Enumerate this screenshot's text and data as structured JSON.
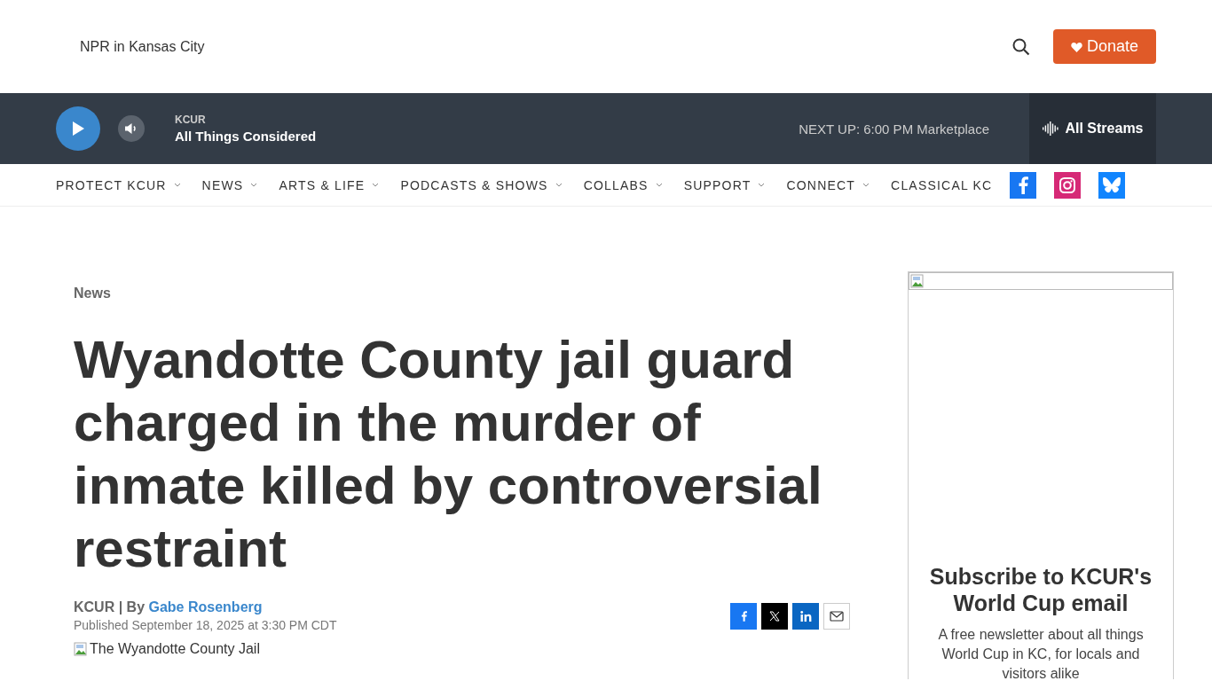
{
  "header": {
    "tagline": "NPR in Kansas City",
    "donate": "Donate"
  },
  "player": {
    "station": "KCUR",
    "show": "All Things Considered",
    "next_up": "NEXT UP: 6:00 PM Marketplace",
    "streams": "All Streams"
  },
  "nav": {
    "items": [
      {
        "label": "PROTECT KCUR",
        "dropdown": true
      },
      {
        "label": "NEWS",
        "dropdown": true
      },
      {
        "label": "ARTS & LIFE",
        "dropdown": true
      },
      {
        "label": "PODCASTS & SHOWS",
        "dropdown": true
      },
      {
        "label": "COLLABS",
        "dropdown": true
      },
      {
        "label": "SUPPORT",
        "dropdown": true
      },
      {
        "label": "CONNECT",
        "dropdown": true
      },
      {
        "label": "CLASSICAL KC",
        "dropdown": false
      }
    ],
    "social": [
      {
        "kind": "facebook",
        "color": "#1877f2"
      },
      {
        "kind": "instagram",
        "color": "#d62976"
      },
      {
        "kind": "bluesky",
        "color": "#1185fe"
      }
    ]
  },
  "article": {
    "section": "News",
    "title": "Wyandotte County jail guard charged in the murder of inmate killed by controversial restraint",
    "source": "KCUR | By",
    "author": "Gabe Rosenberg",
    "published": "Published September 18, 2025 at 3:30 PM CDT",
    "share": [
      {
        "kind": "facebook"
      },
      {
        "kind": "x"
      },
      {
        "kind": "linkedin"
      },
      {
        "kind": "email"
      }
    ],
    "image_alt": "The Wyandotte County Jail"
  },
  "sidebar": {
    "title": "Subscribe to KCUR's World Cup email",
    "text": "A free newsletter about all things World Cup in KC, for locals and visitors alike"
  }
}
